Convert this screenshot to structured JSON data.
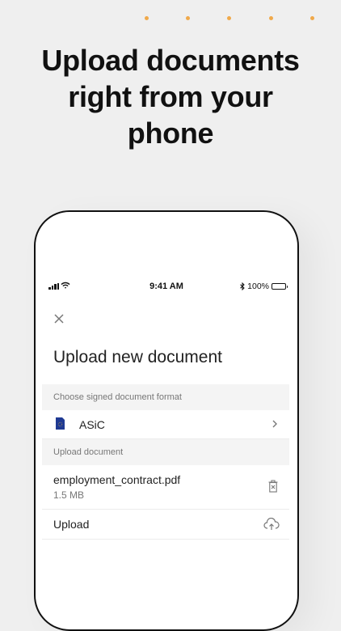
{
  "headline": {
    "line1": "Upload documents",
    "line2": "right from your",
    "line3": "phone"
  },
  "status_bar": {
    "time": "9:41 AM",
    "battery_percent": "100%",
    "icons": [
      "signal-icon",
      "wifi-icon",
      "bluetooth-icon",
      "battery-icon"
    ]
  },
  "screen": {
    "title": "Upload new document",
    "format_section": {
      "header": "Choose signed document format",
      "selected": {
        "label": "ASiC",
        "icon": "eu-document-icon"
      }
    },
    "upload_section": {
      "header": "Upload document",
      "file": {
        "name": "employment_contract.pdf",
        "size": "1.5 MB"
      },
      "upload_label": "Upload"
    }
  },
  "colors": {
    "background": "#efefef",
    "dots": "#f0a94a",
    "document_icon": "#1f3a93"
  }
}
